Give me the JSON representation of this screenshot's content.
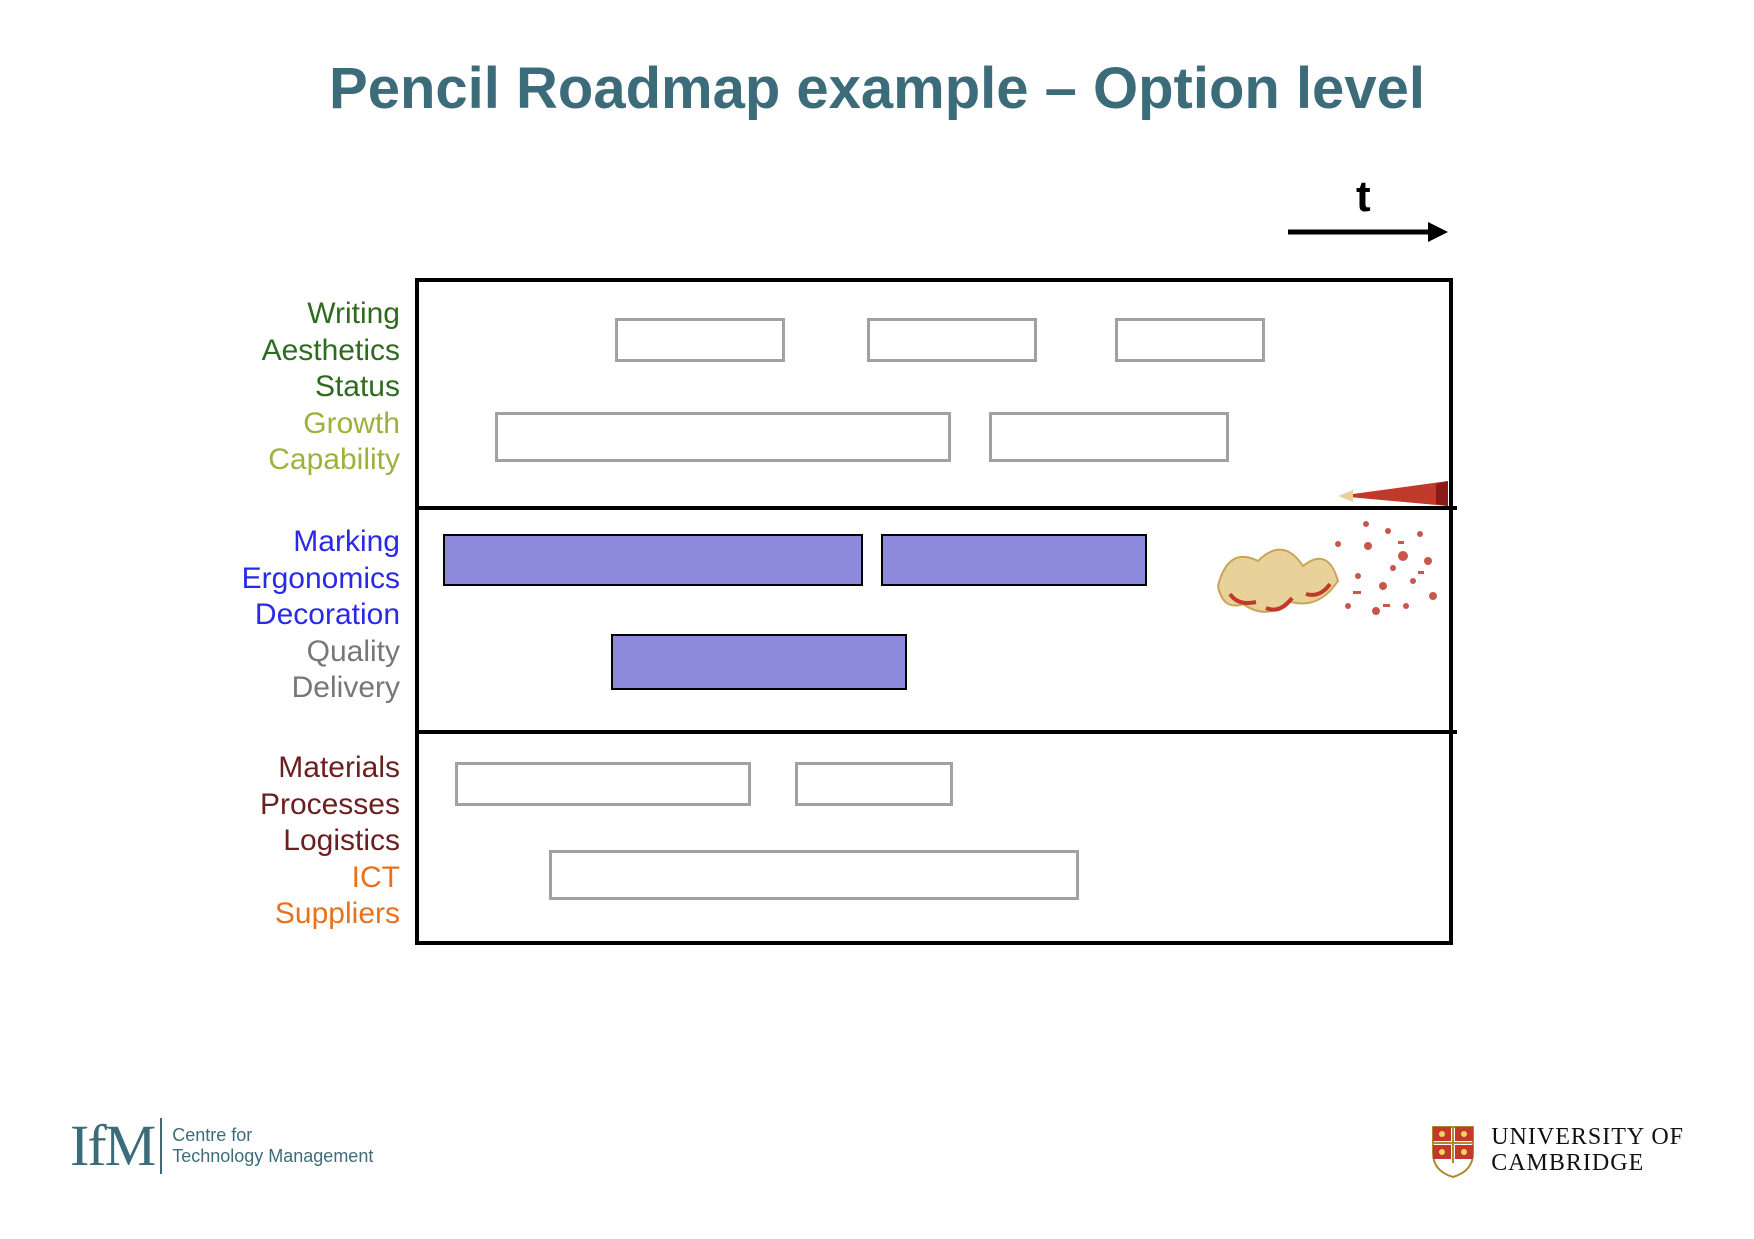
{
  "title": "Pencil Roadmap example – Option level",
  "time_axis_label": "t",
  "rows": {
    "top": {
      "labels": [
        {
          "text": "Writing",
          "color": "#2f6b1f"
        },
        {
          "text": "Aesthetics",
          "color": "#2f6b1f"
        },
        {
          "text": "Status",
          "color": "#2f6b1f"
        },
        {
          "text": "Growth",
          "color": "#9db23b"
        },
        {
          "text": "Capability",
          "color": "#9db23b"
        }
      ]
    },
    "middle": {
      "labels": [
        {
          "text": "Marking",
          "color": "#2a2ae6"
        },
        {
          "text": "Ergonomics",
          "color": "#2a2ae6"
        },
        {
          "text": "Decoration",
          "color": "#2a2ae6"
        },
        {
          "text": "Quality",
          "color": "#777"
        },
        {
          "text": "Delivery",
          "color": "#777"
        }
      ]
    },
    "bottom": {
      "labels": [
        {
          "text": "Materials",
          "color": "#6b1f1f"
        },
        {
          "text": "Processes",
          "color": "#6b1f1f"
        },
        {
          "text": "Logistics",
          "color": "#6b1f1f"
        },
        {
          "text": "ICT",
          "color": "#e8711a"
        },
        {
          "text": "Suppliers",
          "color": "#e8711a"
        }
      ]
    }
  },
  "footer": {
    "ifm": "IfM",
    "ifm_sub1": "Centre for",
    "ifm_sub2": "Technology Management",
    "univ1": "UNIVERSITY OF",
    "univ2": "CAMBRIDGE"
  },
  "image": {
    "description": "Red pencil being sharpened with wood and red shavings"
  }
}
